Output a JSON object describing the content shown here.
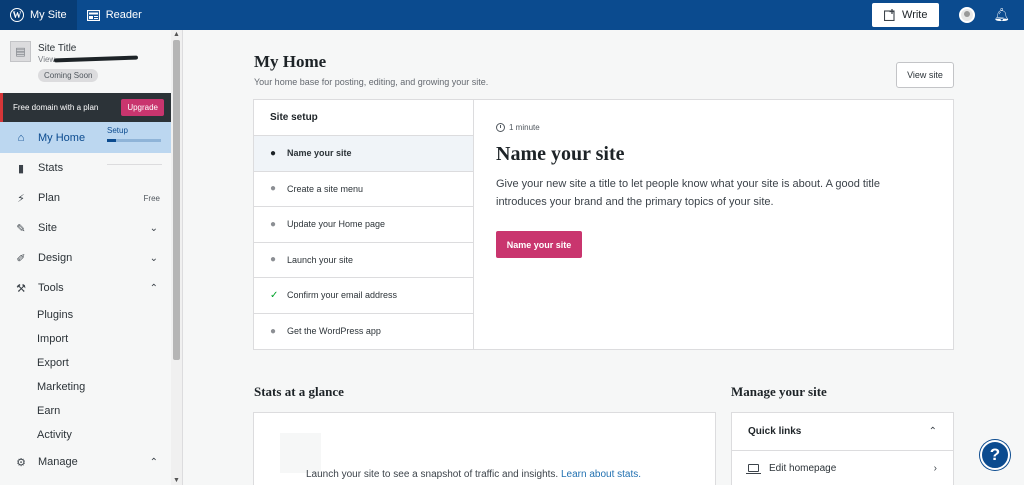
{
  "topbar": {
    "my_site": "My Site",
    "reader": "Reader",
    "write": "Write"
  },
  "sidebar": {
    "site_title": "Site Title",
    "site_view": "View",
    "coming_soon": "Coming Soon",
    "domain_banner": "Free domain with a plan",
    "upgrade": "Upgrade",
    "my_home": "My Home",
    "setup_label": "Setup",
    "setup_progress": 0.17,
    "stats": "Stats",
    "plan": "Plan",
    "plan_badge": "Free",
    "site": "Site",
    "design": "Design",
    "tools": "Tools",
    "tools_sub": [
      "Plugins",
      "Import",
      "Export",
      "Marketing",
      "Earn",
      "Activity"
    ],
    "manage": "Manage"
  },
  "main": {
    "title": "My Home",
    "subtitle": "Your home base for posting, editing, and growing your site.",
    "view_site": "View site",
    "setup": {
      "heading": "Site setup",
      "tasks": [
        {
          "label": "Name your site",
          "state": "active"
        },
        {
          "label": "Create a site menu",
          "state": "todo"
        },
        {
          "label": "Update your Home page",
          "state": "todo"
        },
        {
          "label": "Launch your site",
          "state": "todo"
        },
        {
          "label": "Confirm your email address",
          "state": "done"
        },
        {
          "label": "Get the WordPress app",
          "state": "todo"
        }
      ],
      "duration": "1 minute",
      "detail_title": "Name your site",
      "detail_desc": "Give your new site a title to let people know what your site is about. A good title introduces your brand and the primary topics of your site.",
      "cta": "Name your site"
    },
    "stats": {
      "heading": "Stats at a glance",
      "text": "Launch your site to see a snapshot of traffic and insights.",
      "link": "Learn about stats."
    },
    "manage": {
      "heading": "Manage your site",
      "quick_links": "Quick links",
      "edit_homepage": "Edit homepage"
    },
    "help": "?"
  },
  "colors": {
    "topbar": "#0b4b8f",
    "accent_pink": "#c9356e",
    "active_nav": "#bcd7f0",
    "check_green": "#00a32a",
    "link": "#2271b1"
  }
}
